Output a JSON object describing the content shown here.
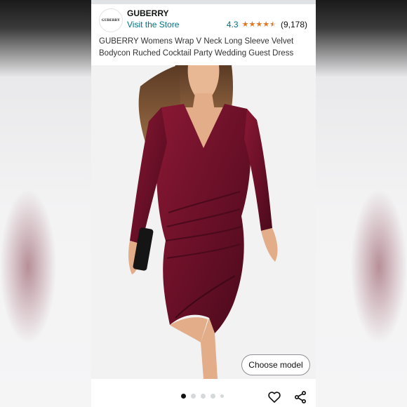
{
  "brand": {
    "logo_text": "GUBERRY",
    "name": "GUBERRY",
    "visit_store": "Visit the Store"
  },
  "rating": {
    "score": "4.3",
    "stars": 4.5,
    "count": "(9,178)",
    "star_color": "#de7921"
  },
  "product": {
    "title": "GUBERRY Womens Wrap V Neck Long Sleeve Velvet Bodycon Ruched Cocktail Party Wedding Guest Dress"
  },
  "image_gallery": {
    "choose_model_label": "Choose model",
    "dots": [
      "active",
      "inactive",
      "inactive",
      "inactive",
      "inactive-small"
    ]
  },
  "actions": {
    "wishlist_icon": "heart-icon",
    "share_icon": "share-icon"
  },
  "colors": {
    "link": "#007185",
    "dress": "#6b1028"
  }
}
